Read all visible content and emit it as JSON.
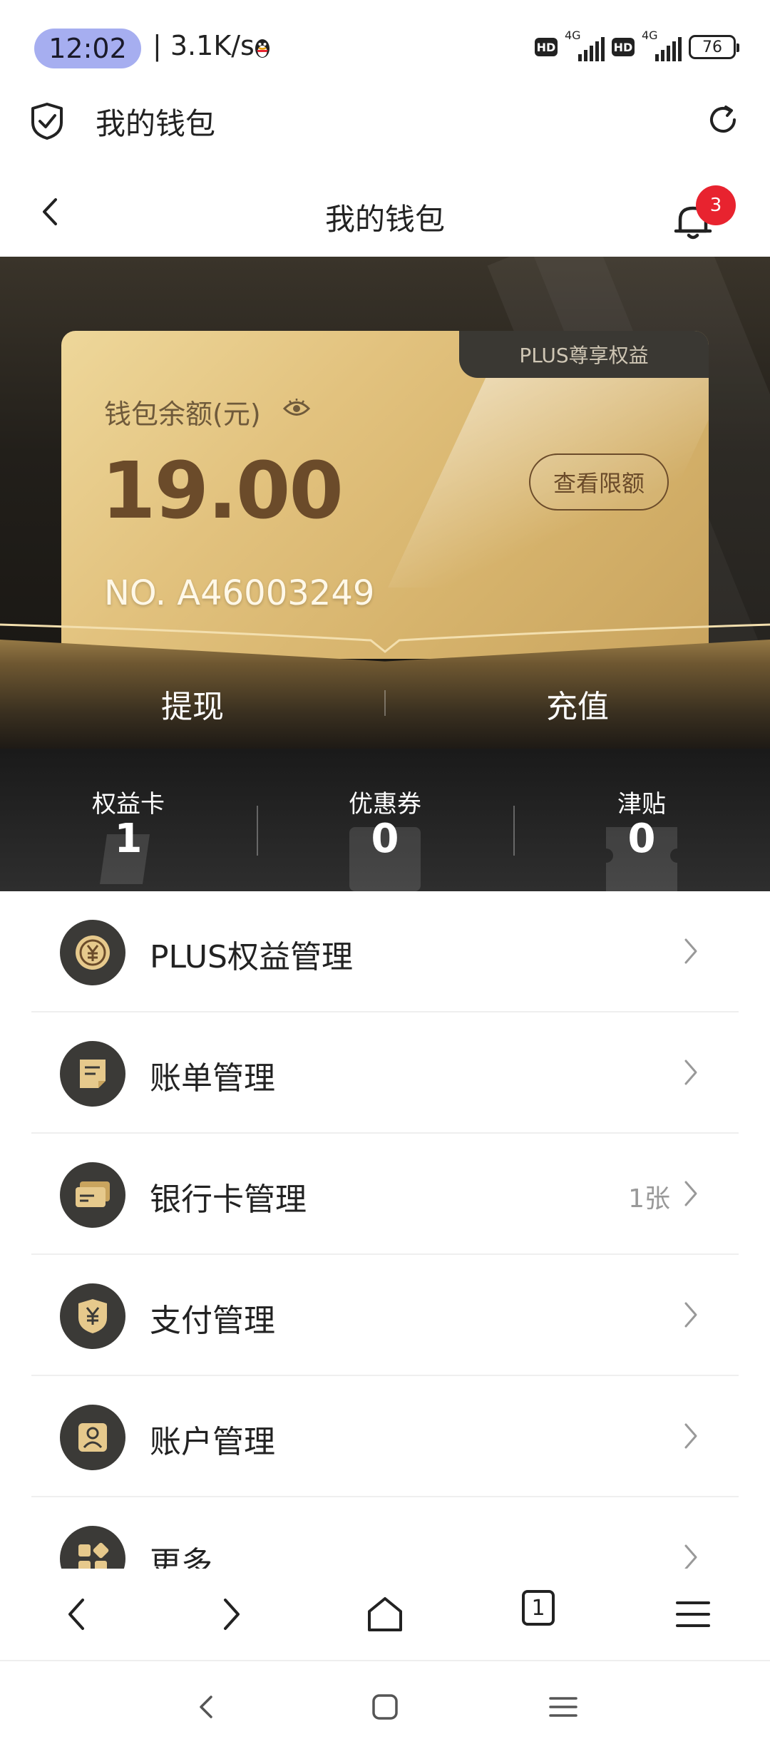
{
  "status_bar": {
    "time": "12:02",
    "net_speed": "| 3.1K/s",
    "hd_label": "HD",
    "network_type": "4G",
    "battery": "76"
  },
  "browser": {
    "title": "我的钱包"
  },
  "header": {
    "title": "我的钱包",
    "notification_count": "3"
  },
  "card": {
    "plus_tab": "PLUS尊享权益",
    "balance_label": "钱包余额(元)",
    "balance": "19.00",
    "limit_button": "查看限额",
    "card_number": "NO. A46003249"
  },
  "actions": {
    "withdraw": "提现",
    "recharge": "充值"
  },
  "stats": [
    {
      "label": "权益卡",
      "value": "1"
    },
    {
      "label": "优惠券",
      "value": "0"
    },
    {
      "label": "津贴",
      "value": "0"
    }
  ],
  "menu": [
    {
      "label": "PLUS权益管理",
      "extra": "",
      "icon": "yuan-coin-icon"
    },
    {
      "label": "账单管理",
      "extra": "",
      "icon": "bill-icon"
    },
    {
      "label": "银行卡管理",
      "extra": "1张",
      "icon": "bank-card-icon"
    },
    {
      "label": "支付管理",
      "extra": "",
      "icon": "yuan-shield-icon"
    },
    {
      "label": "账户管理",
      "extra": "",
      "icon": "account-icon"
    },
    {
      "label": "更多",
      "extra": "",
      "icon": "grid-icon"
    }
  ],
  "browser_nav": {
    "tab_count": "1"
  },
  "colors": {
    "gold_card": "#e2c27e",
    "brown_text": "#6b4b2a",
    "badge_red": "#e8232f",
    "dark_bg": "#141414"
  }
}
